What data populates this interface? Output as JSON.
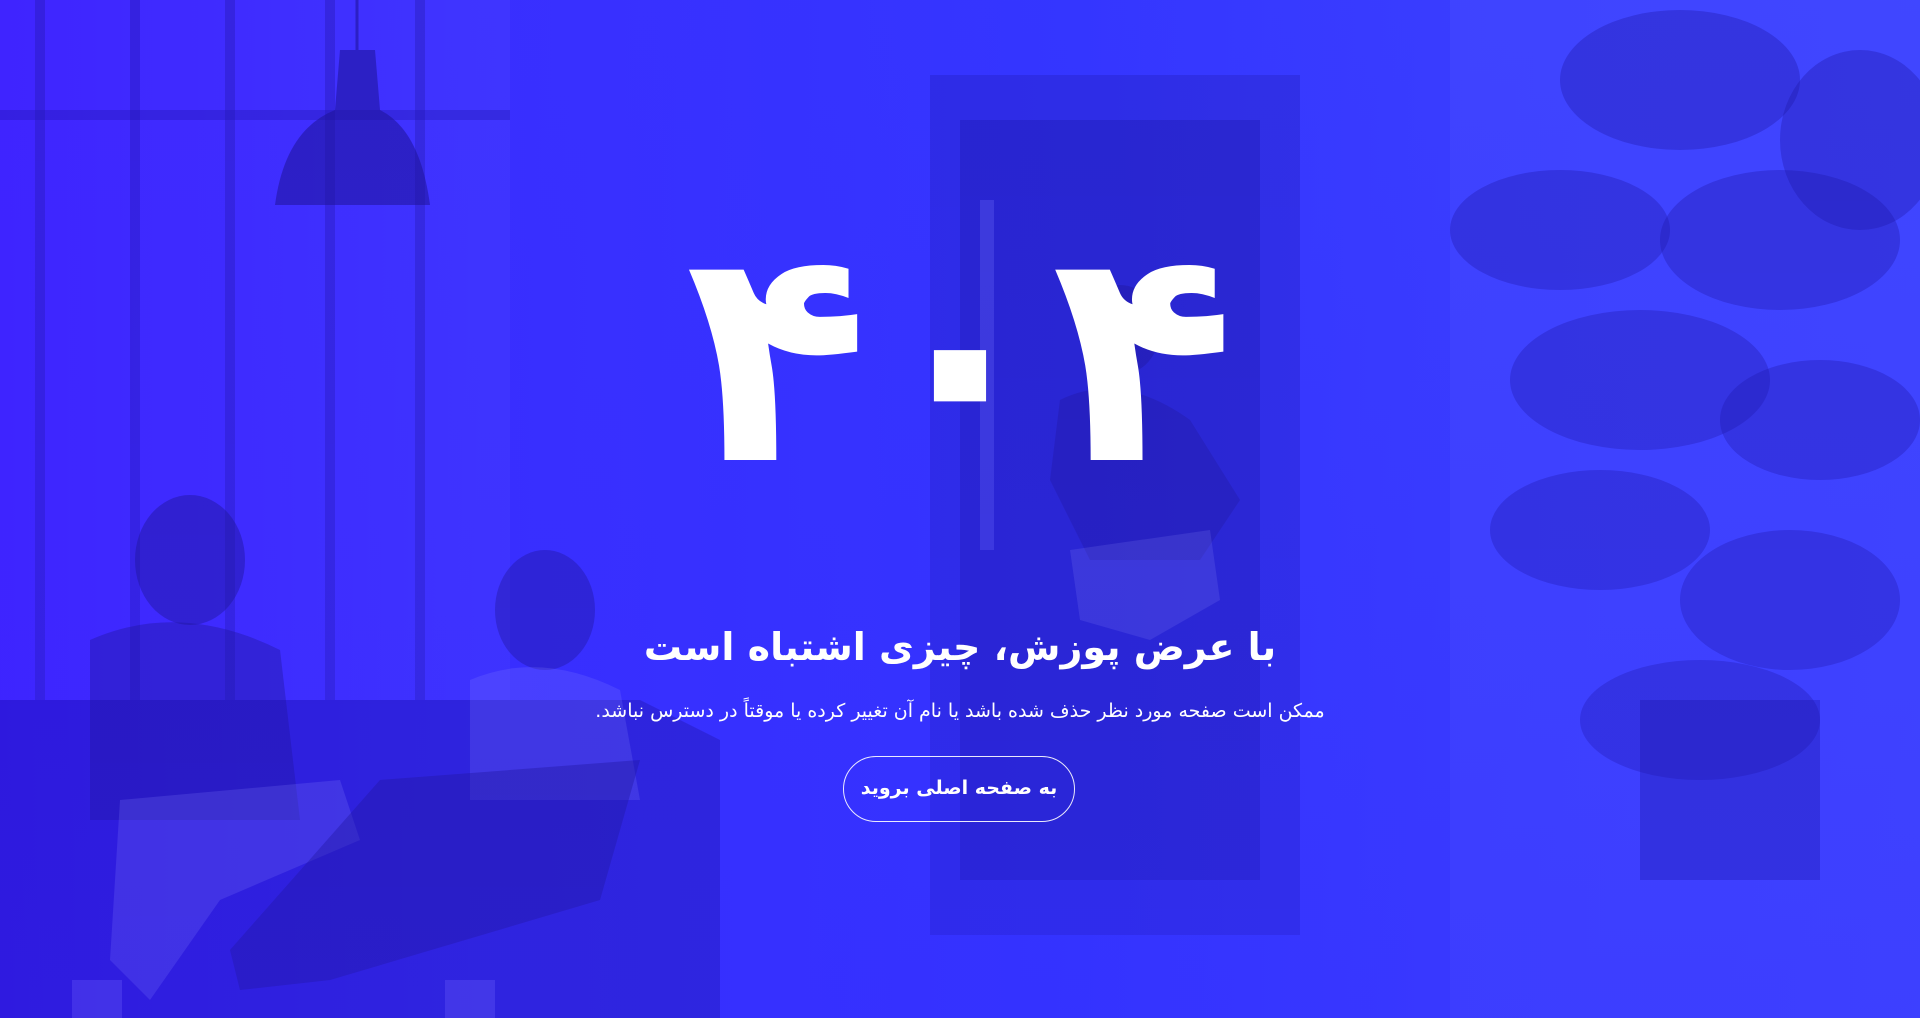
{
  "error": {
    "code": "۴۰۴",
    "heading": "با عرض پوزش، چیزی اشتباه است",
    "message": "ممکن است صفحه مورد نظر حذف شده باشد یا نام آن تغییر کرده یا موقتاً در دسترس نباشد.",
    "home_button": "به صفحه اصلی بروید"
  },
  "colors": {
    "overlay": "#3a30ff",
    "text": "#ffffff"
  }
}
